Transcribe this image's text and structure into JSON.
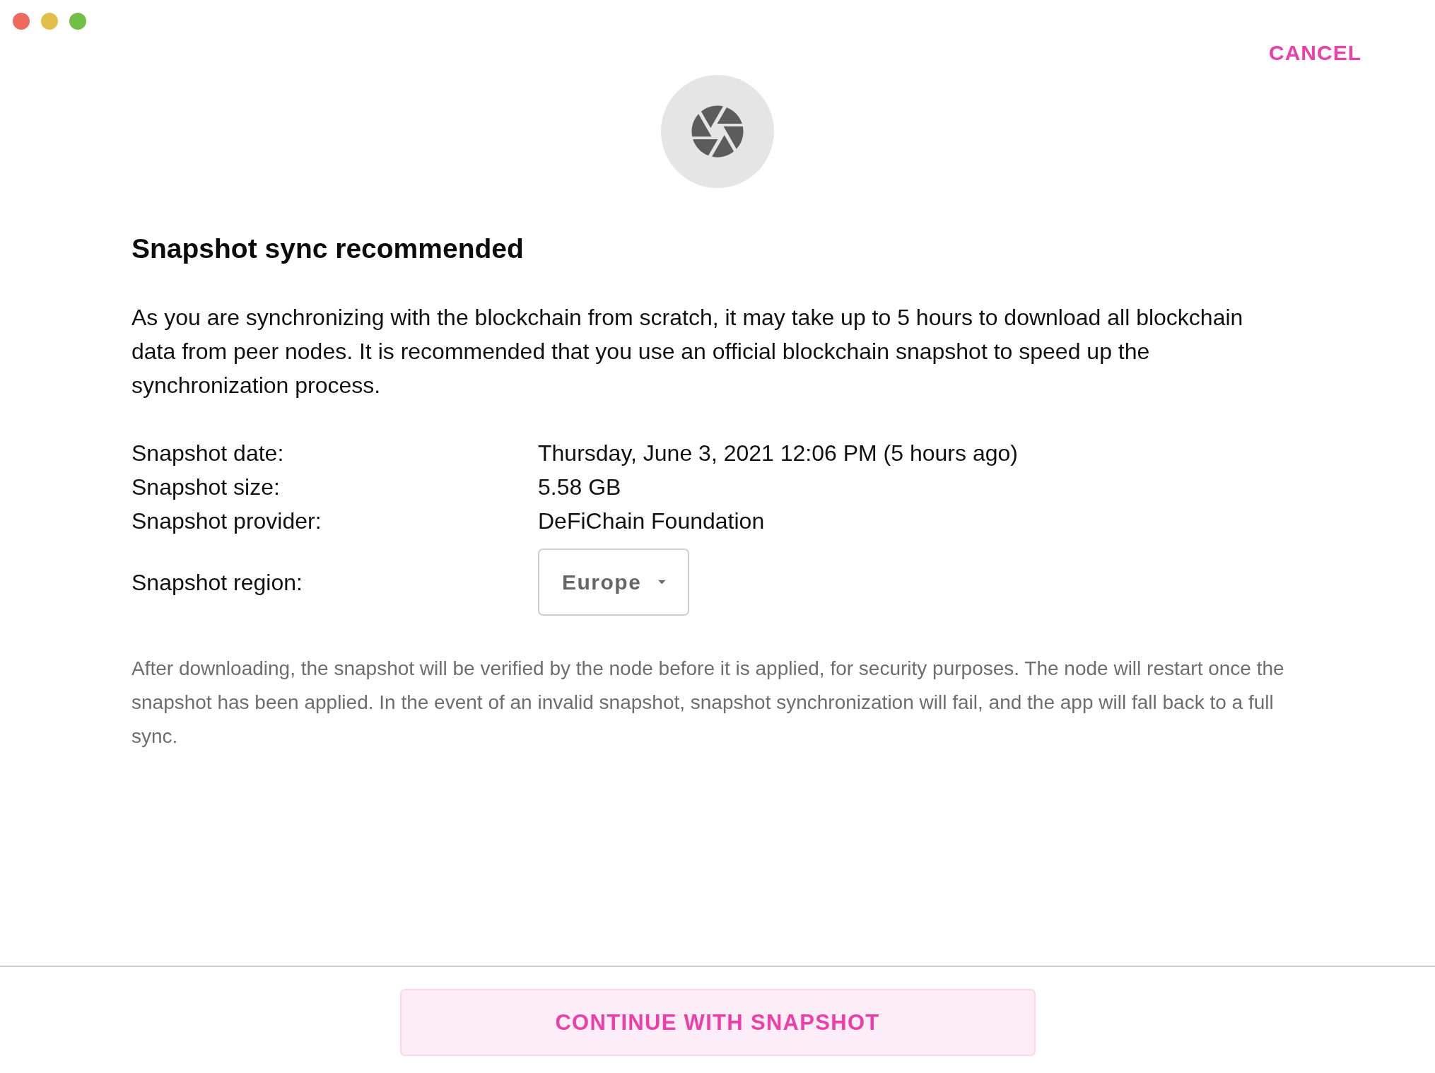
{
  "window": {
    "controls": [
      {
        "kind": "close"
      },
      {
        "kind": "minimize"
      },
      {
        "kind": "zoom"
      }
    ]
  },
  "header": {
    "cancel_button": "CANCEL"
  },
  "dialog": {
    "title": "Snapshot sync recommended",
    "message": "As you are synchronizing with the blockchain from scratch, it may take up to 5 hours to download all blockchain data from peer nodes. It is recommended that you use an official blockchain snapshot to speed up the synchronization process.",
    "details": [
      {
        "label": "Snapshot date:",
        "value": "Thursday, June 3, 2021 12:06 PM (5 hours ago)"
      },
      {
        "label": "Snapshot size:",
        "value": "5.58 GB"
      },
      {
        "label": "Snapshot provider:",
        "value": "DeFiChain Foundation"
      }
    ],
    "region": {
      "label": "Snapshot region:",
      "value": "Europe"
    },
    "note": "After downloading, the snapshot will be verified by the node before it is applied, for security purposes. The node will restart once the snapshot has been applied. In the event of an invalid snapshot, snapshot synchronization will fail, and the app will fall back to a full sync."
  },
  "footer": {
    "primary_button": "CONTINUE WITH SNAPSHOT"
  }
}
